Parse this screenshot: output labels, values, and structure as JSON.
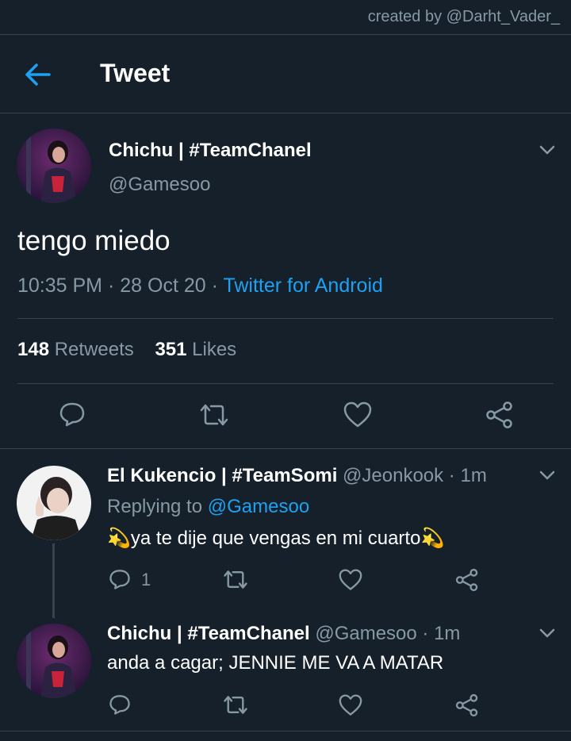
{
  "watermark": "created by @Darht_Vader_",
  "header": {
    "title": "Tweet"
  },
  "main_tweet": {
    "author_name": "Chichu | #TeamChanel",
    "author_handle": "@Gamesoo",
    "text": "tengo miedo",
    "time": "10:35 PM",
    "date": "28 Oct 20",
    "separator": "·",
    "source": "Twitter for Android",
    "retweets_count": "148",
    "retweets_label": "Retweets",
    "likes_count": "351",
    "likes_label": "Likes"
  },
  "replies": [
    {
      "author_name": "El Kukencio | #TeamSomi",
      "author_handle": "@Jeonkook",
      "time": "1m",
      "replying_prefix": "Replying to",
      "replying_to": "@Gamesoo",
      "text": "💫ya te dije que vengas en mi cuarto💫",
      "reply_count": "1"
    },
    {
      "author_name": "Chichu | #TeamChanel",
      "author_handle": "@Gamesoo",
      "time": "1m",
      "text": "anda a cagar; JENNIE ME VA A MATAR"
    }
  ],
  "colors": {
    "background": "#15202b",
    "accent": "#1da1f2",
    "secondary_text": "#8899a6",
    "divider": "#38444d"
  },
  "icons": [
    "back-arrow-icon",
    "chevron-down-icon",
    "reply-icon",
    "retweet-icon",
    "like-icon",
    "share-icon"
  ]
}
